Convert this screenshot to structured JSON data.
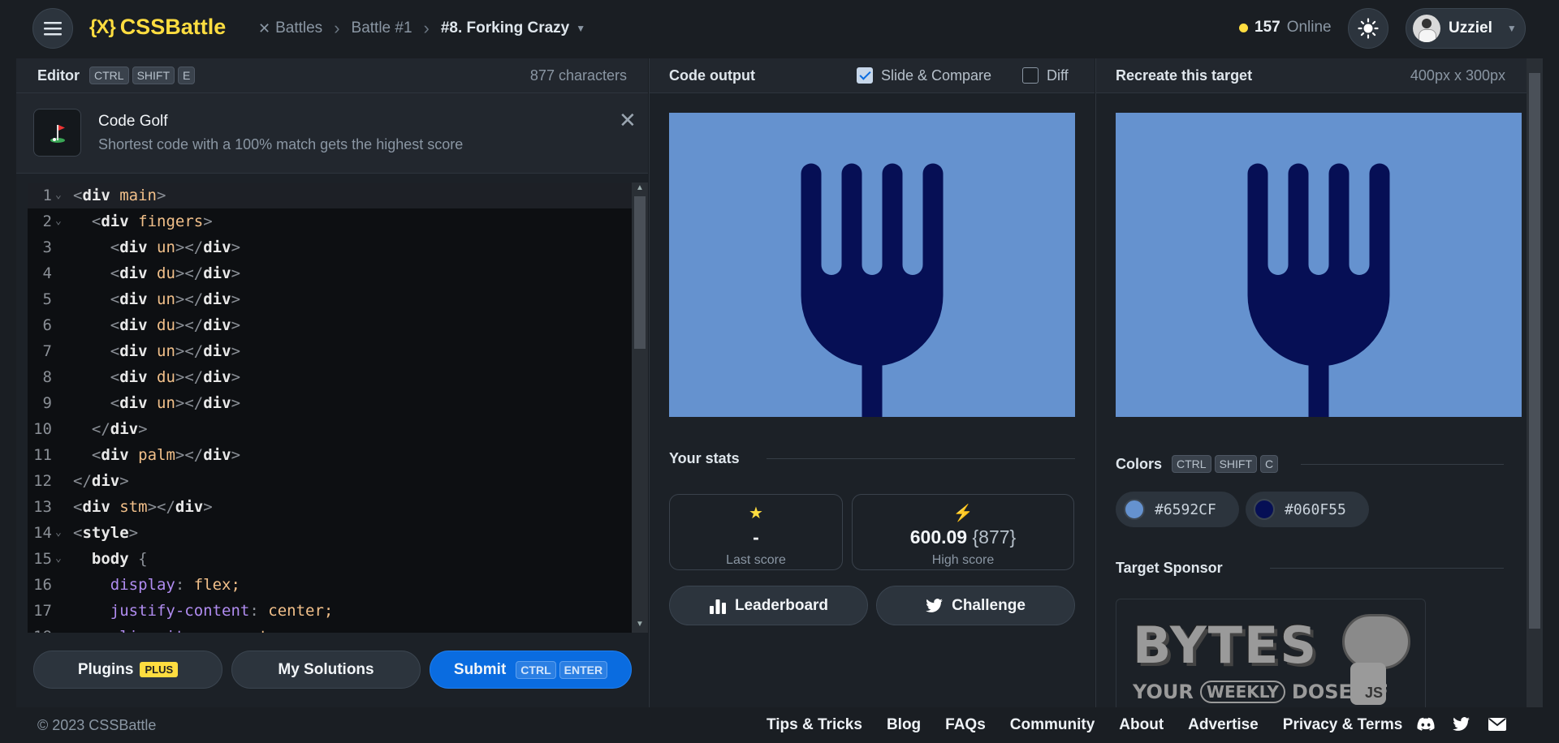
{
  "header": {
    "logo_text": "CSSBattle",
    "logo_mark": "{X}",
    "breadcrumb": [
      "Battles",
      "Battle #1",
      "#8. Forking Crazy"
    ],
    "online_count": "157",
    "online_label": "Online",
    "username": "Uzziel"
  },
  "editor": {
    "title": "Editor",
    "shortcut": [
      "CTRL",
      "SHIFT",
      "E"
    ],
    "char_count": "877 characters",
    "golf_title": "Code Golf",
    "golf_desc": "Shortest code with a 100% match gets the highest score",
    "lines": [
      "<div main>",
      "  <div fingers>",
      "    <div un></div>",
      "    <div du></div>",
      "    <div un></div>",
      "    <div du></div>",
      "    <div un></div>",
      "    <div du></div>",
      "    <div un></div>",
      "  </div>",
      "  <div palm></div>",
      "</div>",
      "<div stm></div>",
      "<style>",
      "  body {",
      "    display: flex;",
      "    justify-content: center;",
      "    align-items: center;"
    ]
  },
  "buttons": {
    "plugins": "Plugins",
    "plus_badge": "PLUS",
    "my_solutions": "My Solutions",
    "submit": "Submit",
    "submit_keys": [
      "CTRL",
      "ENTER"
    ]
  },
  "output": {
    "title": "Code output",
    "slide_compare": "Slide & Compare",
    "slide_compare_checked": true,
    "diff": "Diff",
    "diff_checked": false,
    "stats_title": "Your stats",
    "last_score_value": "-",
    "last_score_label": "Last score",
    "high_score_value": "600.09",
    "high_score_chars": "{877}",
    "high_score_label": "High score",
    "leaderboard": "Leaderboard",
    "challenge": "Challenge"
  },
  "target": {
    "title": "Recreate this target",
    "size": "400px x 300px",
    "colors_title": "Colors",
    "colors_shortcut": [
      "CTRL",
      "SHIFT",
      "C"
    ],
    "colors": [
      "#6592CF",
      "#060F55"
    ],
    "sponsor_title": "Target Sponsor",
    "sponsor_brand": "BYTES",
    "sponsor_tagline_1": "YOUR",
    "sponsor_tagline_2": "WEEKLY",
    "sponsor_tagline_3": "DOSE OF",
    "sponsor_js": "JS"
  },
  "footer": {
    "copyright": "© 2023 CSSBattle",
    "links": [
      "Tips & Tricks",
      "Blog",
      "FAQs",
      "Community",
      "About",
      "Advertise",
      "Privacy & Terms"
    ]
  },
  "palette": {
    "bg": "#6592cf",
    "fork": "#060f55",
    "accent": "#ffdd40",
    "submit": "#0a6ce0"
  }
}
